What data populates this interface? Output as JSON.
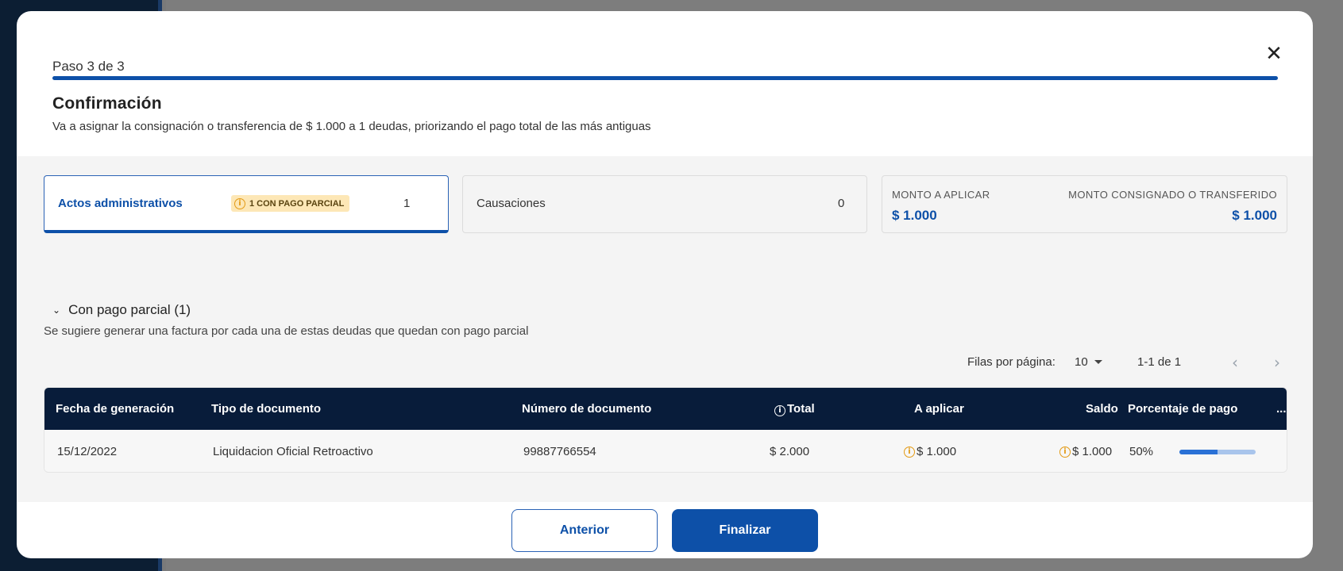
{
  "modal": {
    "step": "Paso 3 de 3",
    "close_icon": "close-icon",
    "title": "Confirmación",
    "subtitle": "Va a asignar la consignación o transferencia de $ 1.000 a 1 deudas, priorizando el pago total de las más antiguas"
  },
  "cards": {
    "actos": {
      "label": "Actos administrativos",
      "badge": "1 CON PAGO PARCIAL",
      "count": "1"
    },
    "causaciones": {
      "label": "Causaciones",
      "count": "0"
    },
    "montos": {
      "aplicar_label": "MONTO A APLICAR",
      "aplicar_value": "$ 1.000",
      "consignado_label": "MONTO CONSIGNADO O TRANSFERIDO",
      "consignado_value": "$ 1.000"
    }
  },
  "section": {
    "title": "Con pago parcial (1)",
    "description": "Se sugiere generar una factura por cada una de estas deudas que quedan con pago parcial"
  },
  "pagination": {
    "rows_label": "Filas por página:",
    "rows_value": "10",
    "range": "1-1 de 1"
  },
  "table": {
    "headers": {
      "fecha": "Fecha de generación",
      "tipo": "Tipo de documento",
      "numero": "Número de documento",
      "total": "Total",
      "aplicar": "A aplicar",
      "saldo": "Saldo",
      "porcentaje": "Porcentaje de pago",
      "more": "..."
    },
    "rows": [
      {
        "fecha": "15/12/2022",
        "tipo": "Liquidacion Oficial Retroactivo",
        "numero": "99887766554",
        "total": "$ 2.000",
        "aplicar": "$ 1.000",
        "saldo": "$ 1.000",
        "porcentaje": "50%",
        "porcentaje_value": 0.5
      }
    ]
  },
  "footer": {
    "prev_label": "Anterior",
    "finish_label": "Finalizar"
  },
  "colors": {
    "primary": "#0d50a8",
    "header_bg": "#081c3a",
    "warning": "#e39a15",
    "badge_bg": "#fde7b6"
  }
}
